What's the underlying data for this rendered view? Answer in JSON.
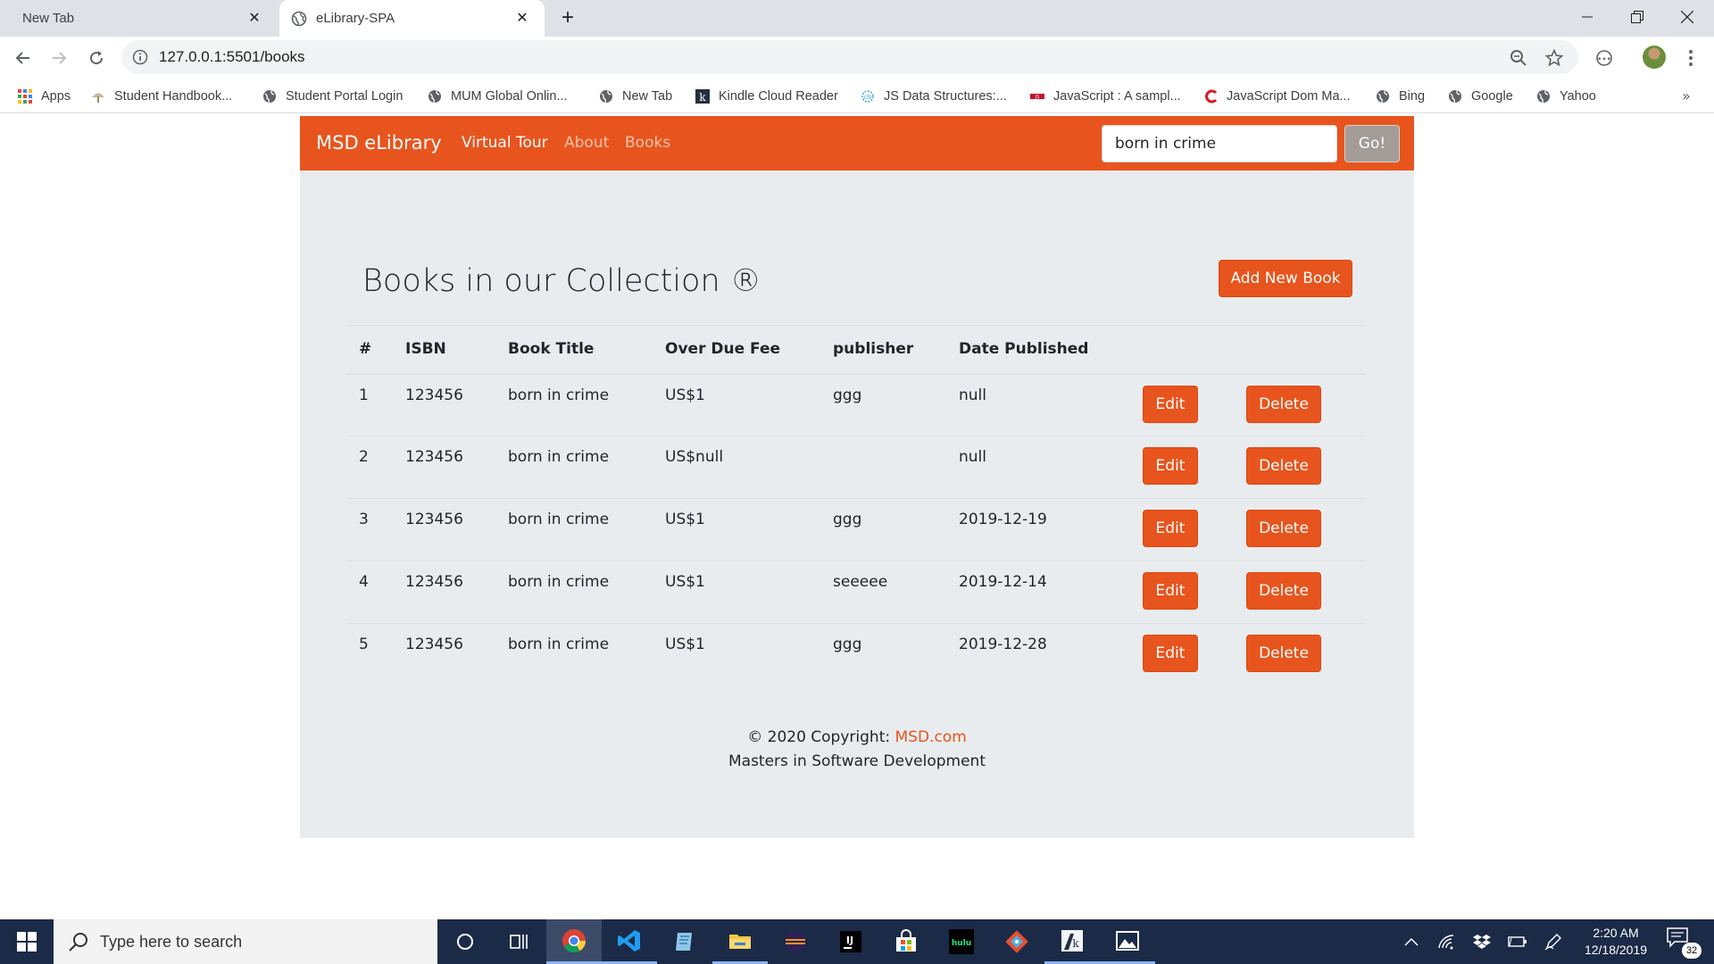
{
  "browser": {
    "tabs": [
      {
        "label": "New Tab",
        "active": false
      },
      {
        "label": "eLibrary-SPA",
        "active": true
      }
    ],
    "url": "127.0.0.1:5501/books",
    "bookmarks": [
      {
        "label": "Apps",
        "icon": "apps-grid-icon"
      },
      {
        "label": "Student Handbook...",
        "icon": "handbook-icon"
      },
      {
        "label": "Student Portal Login",
        "icon": "globe-icon"
      },
      {
        "label": "MUM Global Onlin...",
        "icon": "globe-icon"
      },
      {
        "label": "New Tab",
        "icon": "globe-icon"
      },
      {
        "label": "Kindle Cloud Reader",
        "icon": "kindle-icon"
      },
      {
        "label": "JS Data Structures:...",
        "icon": "codeburst-icon"
      },
      {
        "label": "JavaScript : A sampl...",
        "icon": "javascript-icon"
      },
      {
        "label": "JavaScript Dom Ma...",
        "icon": "dom-icon"
      },
      {
        "label": "Bing",
        "icon": "globe-icon"
      },
      {
        "label": "Google",
        "icon": "globe-icon"
      },
      {
        "label": "Yahoo",
        "icon": "globe-icon"
      }
    ]
  },
  "navbar": {
    "brand": "MSD eLibrary",
    "links": [
      {
        "label": "Virtual Tour",
        "active": true
      },
      {
        "label": "About",
        "active": false
      },
      {
        "label": "Books",
        "active": false
      }
    ],
    "search_value": "born in crime",
    "search_button": "Go!"
  },
  "page": {
    "heading": "Books in our Collection ®",
    "add_button": "Add New Book"
  },
  "table": {
    "headers": [
      "#",
      "ISBN",
      "Book Title",
      "Over Due Fee",
      "publisher",
      "Date Published"
    ],
    "edit_label": "Edit",
    "delete_label": "Delete",
    "rows": [
      {
        "num": "1",
        "isbn": "123456",
        "title": "born in crime",
        "fee": "US$1",
        "publisher": "ggg",
        "date": "null"
      },
      {
        "num": "2",
        "isbn": "123456",
        "title": "born in crime",
        "fee": "US$null",
        "publisher": "",
        "date": "null"
      },
      {
        "num": "3",
        "isbn": "123456",
        "title": "born in crime",
        "fee": "US$1",
        "publisher": "ggg",
        "date": "2019-12-19"
      },
      {
        "num": "4",
        "isbn": "123456",
        "title": "born in crime",
        "fee": "US$1",
        "publisher": "seeeee",
        "date": "2019-12-14"
      },
      {
        "num": "5",
        "isbn": "123456",
        "title": "born in crime",
        "fee": "US$1",
        "publisher": "ggg",
        "date": "2019-12-28"
      }
    ]
  },
  "footer": {
    "copyright_prefix": "© 2020 Copyright: ",
    "copyright_link": "MSD.com",
    "subtitle": "Masters in Software Development"
  },
  "taskbar": {
    "search_placeholder": "Type here to search",
    "time": "2:20 AM",
    "date": "12/18/2019",
    "notification_count": "32"
  },
  "colors": {
    "brand": "#e8541d",
    "page_bg": "#e9ecef",
    "taskbar": "#1b2a47"
  }
}
